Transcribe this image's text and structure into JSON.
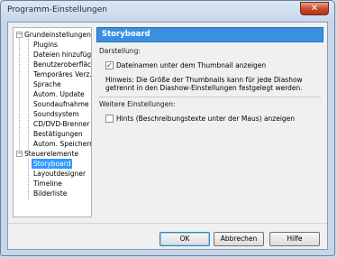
{
  "window": {
    "title": "Programm-Einstellungen"
  },
  "tree": {
    "group1": "Grundeinstellungen",
    "items1": [
      "Plugins",
      "Dateien hinzufügen",
      "Benutzeroberfläche",
      "Temporäres Verz...",
      "Sprache",
      "Autom. Update",
      "Soundaufnahme",
      "Soundsystem",
      "CD/DVD-Brenner",
      "Bestätigungen",
      "Autom. Speichern"
    ],
    "group2": "Steuerelemente",
    "items2": [
      "Storyboard",
      "Layoutdesigner",
      "Timeline",
      "Bilderliste"
    ],
    "collapse_glyph": "−"
  },
  "panel": {
    "header": "Storyboard",
    "section1": "Darstellung:",
    "checkbox1": "Dateinamen unter dem Thumbnail anzeigen",
    "checkbox1_checked": true,
    "hint": "Hinweis: Die Größe der Thumbnails kann für jede Diashow getrennt in den Diashow-Einstellungen festgelegt werden.",
    "section2": "Weitere Einstellungen:",
    "checkbox2": "Hints (Beschreibungstexte unter der Maus) anzeigen",
    "checkbox2_checked": false
  },
  "buttons": {
    "ok": "OK",
    "cancel": "Abbrechen",
    "help": "Hilfe"
  },
  "glyphs": {
    "close": "✕",
    "check": "✓"
  }
}
